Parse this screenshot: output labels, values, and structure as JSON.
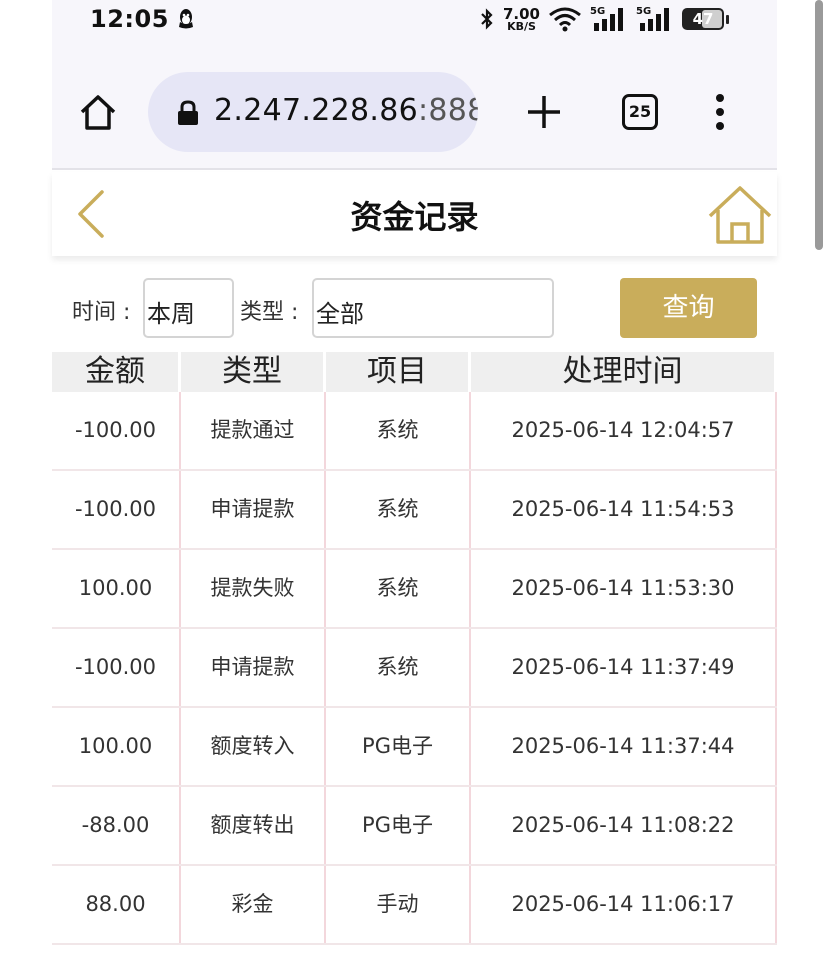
{
  "status_bar": {
    "time": "12:05",
    "net_speed_value": "7.00",
    "net_speed_unit": "KB/S",
    "sim1": "5G",
    "sim2": "5G",
    "battery": "47"
  },
  "browser": {
    "url_host": "2.247.228.86",
    "url_port": ":888",
    "tab_count": "25"
  },
  "page": {
    "title": "资金记录"
  },
  "filters": {
    "time_label": "时间 :",
    "time_value": "本周",
    "type_label": "类型 :",
    "type_value": "全部",
    "query_button": "查询"
  },
  "table": {
    "headers": [
      "金额",
      "类型",
      "项目",
      "处理时间"
    ],
    "rows": [
      [
        "-100.00",
        "提款通过",
        "系统",
        "2025-06-14 12:04:57"
      ],
      [
        "-100.00",
        "申请提款",
        "系统",
        "2025-06-14 11:54:53"
      ],
      [
        "100.00",
        "提款失败",
        "系统",
        "2025-06-14 11:53:30"
      ],
      [
        "-100.00",
        "申请提款",
        "系统",
        "2025-06-14 11:37:49"
      ],
      [
        "100.00",
        "额度转入",
        "PG电子",
        "2025-06-14 11:37:44"
      ],
      [
        "-88.00",
        "额度转出",
        "PG电子",
        "2025-06-14 11:08:22"
      ],
      [
        "88.00",
        "彩金",
        "手动",
        "2025-06-14 11:06:17"
      ]
    ]
  },
  "colors": {
    "accent_gold": "#c9ad5b",
    "header_gray": "#efefef",
    "browser_bg": "#f7f6fb",
    "urlbar_bg": "#e6e6f6"
  },
  "icons": {
    "back": "chevron-left-icon",
    "home": "house-icon",
    "browser_home": "home-icon",
    "lock": "lock-icon",
    "new_tab": "plus-icon",
    "menu": "more-vertical-icon"
  }
}
